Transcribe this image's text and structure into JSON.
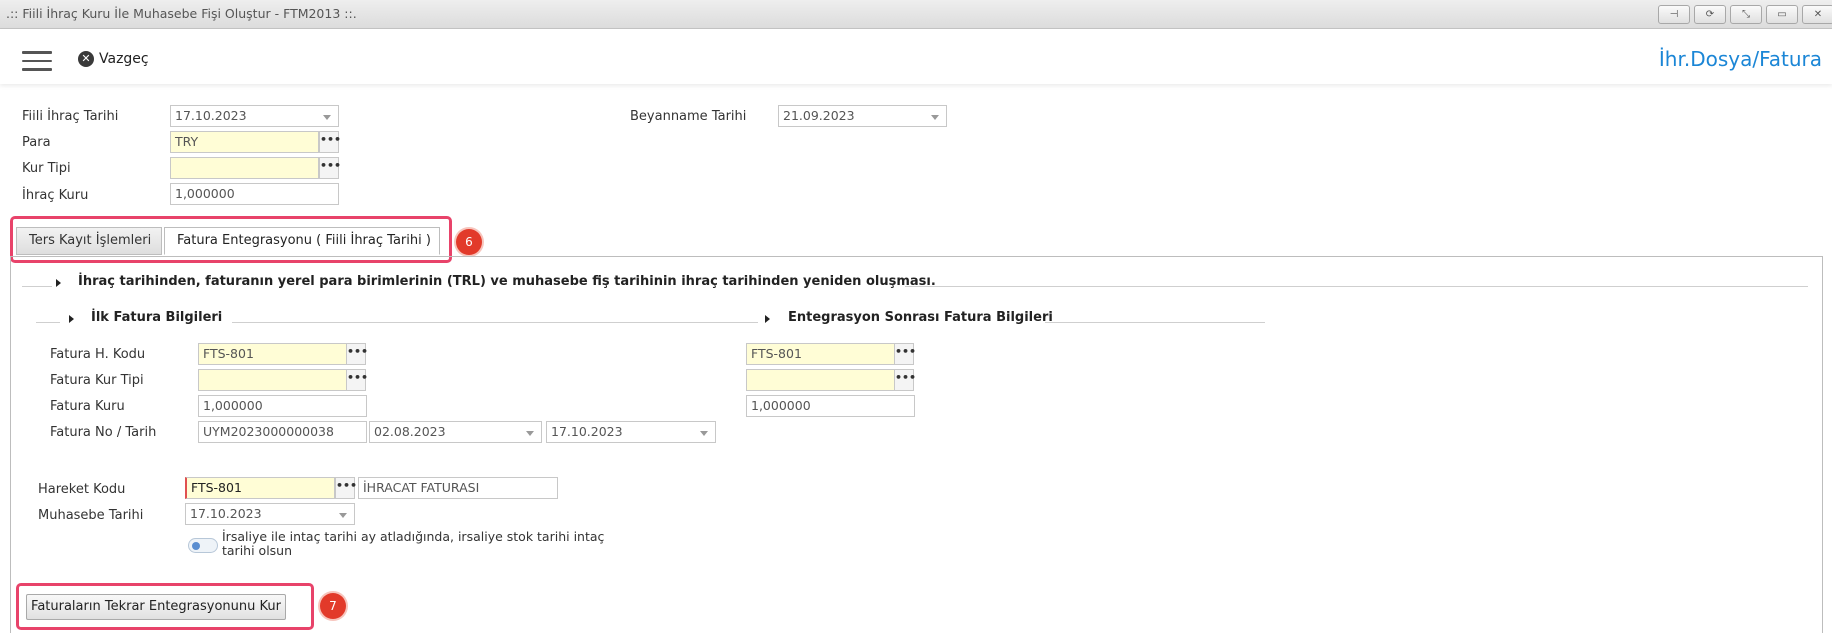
{
  "window": {
    "title": ".:: Fiili İhraç Kuru İle Muhasebe Fişi Oluştur - FTM2013 ::.",
    "buttons": [
      "pin-icon",
      "refresh-icon",
      "restore-icon",
      "maximize-icon",
      "close-icon"
    ]
  },
  "toolbar": {
    "cancel_label": "Vazgeç",
    "right_link": "İhr.Dosya/Fatura"
  },
  "header_form": {
    "fiili_ihrac_tarihi_label": "Fiili İhraç Tarihi",
    "fiili_ihrac_tarihi_value": "17.10.2023",
    "para_label": "Para",
    "para_value": "TRY",
    "kur_tipi_label": "Kur Tipi",
    "kur_tipi_value": "",
    "ihrac_kuru_label": "İhraç Kuru",
    "ihrac_kuru_value": "1,000000",
    "beyanname_tarihi_label": "Beyanname Tarihi",
    "beyanname_tarihi_value": "21.09.2023"
  },
  "tabs": [
    {
      "label": "Ters Kayıt İşlemleri",
      "active": false
    },
    {
      "label": "Fatura Entegrasyonu ( Fiili İhraç Tarihi )",
      "active": true
    }
  ],
  "badges": {
    "tabs": "6",
    "button": "7"
  },
  "panel": {
    "description": "İhraç tarihinden, faturanın yerel para birimlerinin (TRL) ve muhasebe fiş tarihinin ihraç tarihinden yeniden oluşması.",
    "ilk_fatura_title": "İlk Fatura Bilgileri",
    "sonrasi_title": "Entegrasyon Sonrası Fatura Bilgileri",
    "fatura_h_kodu_label": "Fatura H. Kodu",
    "fatura_h_kodu_value": "FTS-801",
    "fatura_kur_tipi_label": "Fatura Kur Tipi",
    "fatura_kur_tipi_value": "",
    "fatura_kuru_label": "Fatura Kuru",
    "fatura_kuru_value": "1,000000",
    "fatura_no_tarih_label": "Fatura No / Tarih",
    "fatura_no_value": "UYM2023000000038",
    "fatura_tarih1": "02.08.2023",
    "fatura_tarih2": "17.10.2023",
    "sonrasi_h_kodu_value": "FTS-801",
    "sonrasi_kur_tipi_value": "",
    "sonrasi_kuru_value": "1,000000",
    "hareket_kodu_label": "Hareket Kodu",
    "hareket_kodu_value": "FTS-801",
    "hareket_kodu_desc": "İHRACAT FATURASI",
    "muhasebe_tarihi_label": "Muhasebe Tarihi",
    "muhasebe_tarihi_value": "17.10.2023",
    "toggle_label": "İrsaliye ile intaç tarihi ay atladığında, irsaliye stok tarihi intaç tarihi olsun",
    "action_button": "Faturaların Tekrar Entegrasyonunu Kur"
  }
}
